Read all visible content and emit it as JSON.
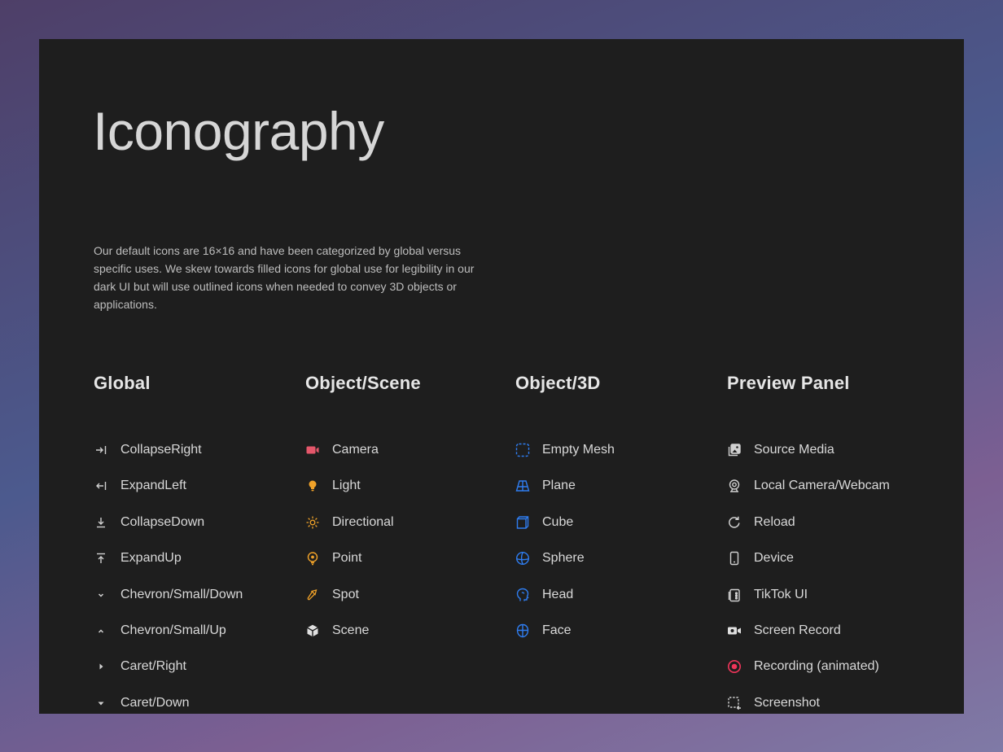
{
  "page": {
    "title": "Iconography",
    "description": "Our default icons are 16×16 and have been categorized by global versus specific uses. We skew towards filled icons for global use for legibility in our dark UI but will use outlined icons when needed to convey 3D objects or applications."
  },
  "colors": {
    "panel": "#1e1e1e",
    "text": "#d9d9d9",
    "global_icon": "#d0d0d0",
    "camera": "#e5576b",
    "light": "#f0a229",
    "object3d": "#2f7df0",
    "recording": "#f0355a"
  },
  "columns": [
    {
      "heading": "Global",
      "items": [
        {
          "label": "CollapseRight",
          "icon": "collapse-right-icon"
        },
        {
          "label": "ExpandLeft",
          "icon": "expand-left-icon"
        },
        {
          "label": "CollapseDown",
          "icon": "collapse-down-icon"
        },
        {
          "label": "ExpandUp",
          "icon": "expand-up-icon"
        },
        {
          "label": "Chevron/Small/Down",
          "icon": "chevron-small-down-icon"
        },
        {
          "label": "Chevron/Small/Up",
          "icon": "chevron-small-up-icon"
        },
        {
          "label": "Caret/Right",
          "icon": "caret-right-icon"
        },
        {
          "label": "Caret/Down",
          "icon": "caret-down-icon"
        }
      ]
    },
    {
      "heading": "Object/Scene",
      "items": [
        {
          "label": "Camera",
          "icon": "camera-icon"
        },
        {
          "label": "Light",
          "icon": "light-bulb-icon"
        },
        {
          "label": "Directional",
          "icon": "directional-light-icon"
        },
        {
          "label": "Point",
          "icon": "point-light-icon"
        },
        {
          "label": "Spot",
          "icon": "spot-light-icon"
        },
        {
          "label": "Scene",
          "icon": "scene-icon"
        }
      ]
    },
    {
      "heading": "Object/3D",
      "items": [
        {
          "label": "Empty Mesh",
          "icon": "empty-mesh-icon"
        },
        {
          "label": "Plane",
          "icon": "plane-icon"
        },
        {
          "label": "Cube",
          "icon": "cube-icon"
        },
        {
          "label": "Sphere",
          "icon": "sphere-icon"
        },
        {
          "label": "Head",
          "icon": "head-icon"
        },
        {
          "label": "Face",
          "icon": "face-icon"
        }
      ]
    },
    {
      "heading": "Preview Panel",
      "items": [
        {
          "label": "Source Media",
          "icon": "source-media-icon"
        },
        {
          "label": "Local Camera/Webcam",
          "icon": "webcam-icon"
        },
        {
          "label": "Reload",
          "icon": "reload-icon"
        },
        {
          "label": "Device",
          "icon": "device-icon"
        },
        {
          "label": "TikTok UI",
          "icon": "tiktok-ui-icon"
        },
        {
          "label": "Screen Record",
          "icon": "screen-record-icon"
        },
        {
          "label": "Recording (animated)",
          "icon": "recording-icon"
        },
        {
          "label": "Screenshot",
          "icon": "screenshot-icon"
        }
      ]
    }
  ]
}
